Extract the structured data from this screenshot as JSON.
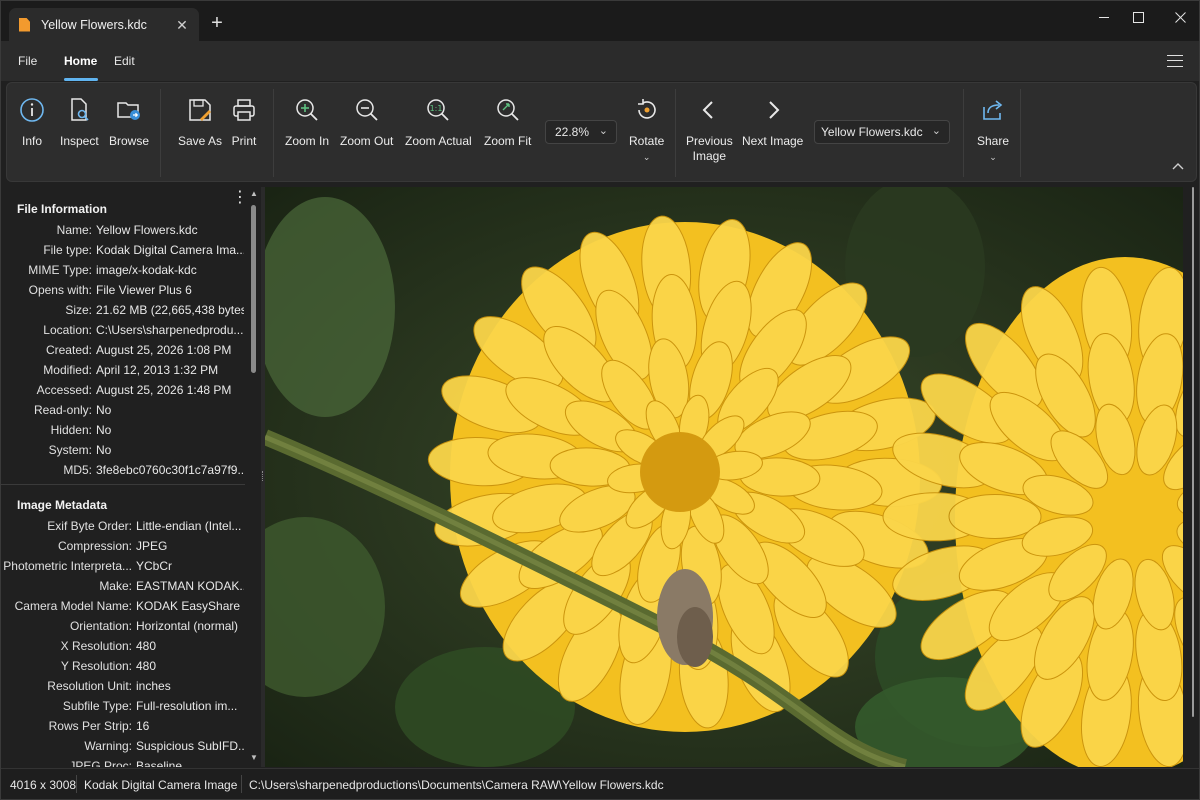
{
  "app": {
    "tab_title": "Yellow Flowers.kdc",
    "tab_close_icon": "close-icon",
    "new_tab_icon": "plus-icon"
  },
  "menu": {
    "file": "File",
    "home": "Home",
    "edit": "Edit"
  },
  "ribbon": {
    "info": "Info",
    "inspect": "Inspect",
    "browse": "Browse",
    "save_as": "Save As",
    "print": "Print",
    "zoom_in": "Zoom In",
    "zoom_out": "Zoom Out",
    "zoom_actual": "Zoom Actual",
    "zoom_fit": "Zoom Fit",
    "zoom_level": "22.8%",
    "rotate": "Rotate",
    "previous_image": "Previous",
    "previous_image_2": "Image",
    "next_image": "Next Image",
    "current_image": "Yellow Flowers.kdc",
    "share": "Share"
  },
  "file_info": {
    "title": "File Information",
    "rows": [
      {
        "key": "Name:",
        "value": "Yellow Flowers.kdc"
      },
      {
        "key": "File type:",
        "value": "Kodak Digital Camera Ima..."
      },
      {
        "key": "MIME Type:",
        "value": "image/x-kodak-kdc"
      },
      {
        "key": "Opens with:",
        "value": "File Viewer Plus 6"
      },
      {
        "key": "Size:",
        "value": "21.62 MB (22,665,438 bytes)"
      },
      {
        "key": "Location:",
        "value": "C:\\Users\\sharpenedprodu..."
      },
      {
        "key": "Created:",
        "value": "August 25, 2026 1:08 PM"
      },
      {
        "key": "Modified:",
        "value": "April 12, 2013 1:32 PM"
      },
      {
        "key": "Accessed:",
        "value": "August 25, 2026 1:48 PM"
      },
      {
        "key": "Read-only:",
        "value": "No"
      },
      {
        "key": "Hidden:",
        "value": "No"
      },
      {
        "key": "System:",
        "value": "No"
      },
      {
        "key": "MD5:",
        "value": "3fe8ebc0760c30f1c7a97f9..."
      }
    ]
  },
  "image_metadata": {
    "title": "Image Metadata",
    "rows": [
      {
        "key": "Exif Byte Order:",
        "value": "Little-endian (Intel..."
      },
      {
        "key": "Compression:",
        "value": "JPEG"
      },
      {
        "key": "Photometric Interpreta...",
        "value": "YCbCr"
      },
      {
        "key": "Make:",
        "value": "EASTMAN KODAK..."
      },
      {
        "key": "Camera Model Name:",
        "value": "KODAK EasyShare ..."
      },
      {
        "key": "Orientation:",
        "value": "Horizontal (normal)"
      },
      {
        "key": "X Resolution:",
        "value": "480"
      },
      {
        "key": "Y Resolution:",
        "value": "480"
      },
      {
        "key": "Resolution Unit:",
        "value": "inches"
      },
      {
        "key": "Subfile Type:",
        "value": "Full-resolution im..."
      },
      {
        "key": "Rows Per Strip:",
        "value": "16"
      },
      {
        "key": "Warning:",
        "value": "Suspicious SubIFD..."
      },
      {
        "key": "JPEG Proc:",
        "value": "Baseline"
      }
    ]
  },
  "status": {
    "dimensions": "4016 x 3008",
    "file_type": "Kodak Digital Camera Image",
    "path": "C:\\Users\\sharpenedproductions\\Documents\\Camera RAW\\Yellow Flowers.kdc"
  }
}
